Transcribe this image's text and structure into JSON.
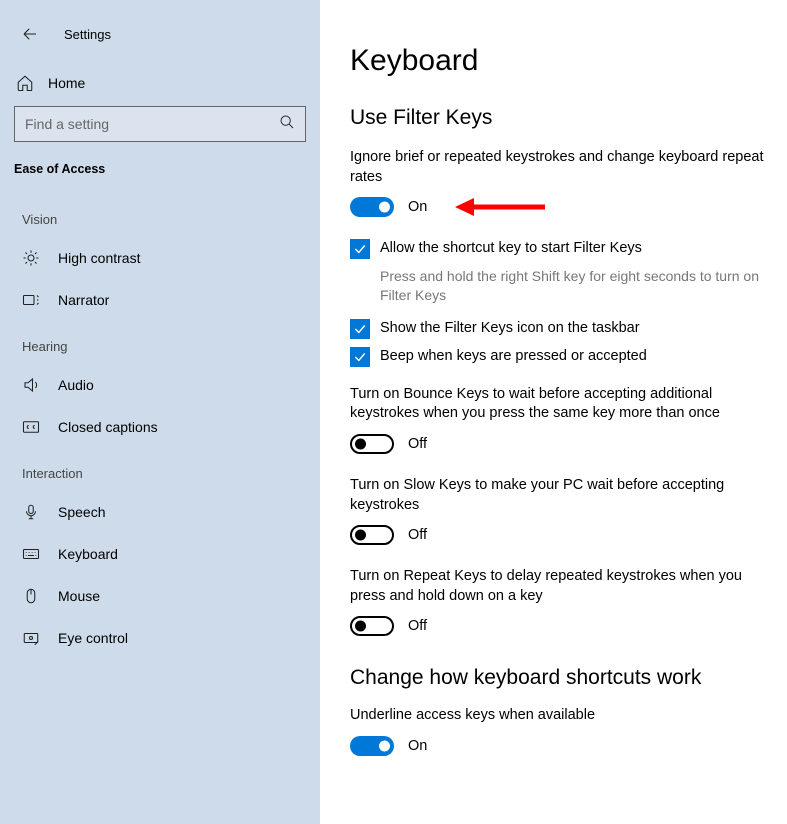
{
  "header": {
    "title": "Settings"
  },
  "sidebar": {
    "home_label": "Home",
    "search_placeholder": "Find a setting",
    "section_label": "Ease of Access",
    "groups": [
      {
        "label": "Vision",
        "items": [
          {
            "label": "High contrast"
          },
          {
            "label": "Narrator"
          }
        ]
      },
      {
        "label": "Hearing",
        "items": [
          {
            "label": "Audio"
          },
          {
            "label": "Closed captions"
          }
        ]
      },
      {
        "label": "Interaction",
        "items": [
          {
            "label": "Speech"
          },
          {
            "label": "Keyboard"
          },
          {
            "label": "Mouse"
          },
          {
            "label": "Eye control"
          }
        ]
      }
    ]
  },
  "main": {
    "page_title": "Keyboard",
    "section1_title": "Use Filter Keys",
    "filter_desc": "Ignore brief or repeated keystrokes and change keyboard repeat rates",
    "toggle_on": "On",
    "toggle_off": "Off",
    "chk_shortcut": "Allow the shortcut key to start Filter Keys",
    "chk_shortcut_desc": "Press and hold the right Shift key for eight seconds to turn on Filter Keys",
    "chk_taskbar": "Show the Filter Keys icon on the taskbar",
    "chk_beep": "Beep when keys are pressed or accepted",
    "bounce_desc": "Turn on Bounce Keys to wait before accepting additional keystrokes when you press the same key more than once",
    "slow_desc": "Turn on Slow Keys to make your PC wait before accepting keystrokes",
    "repeat_desc": "Turn on Repeat Keys to delay repeated keystrokes when you press and hold down on a key",
    "section2_title": "Change how keyboard shortcuts work",
    "underline_desc": "Underline access keys when available"
  }
}
